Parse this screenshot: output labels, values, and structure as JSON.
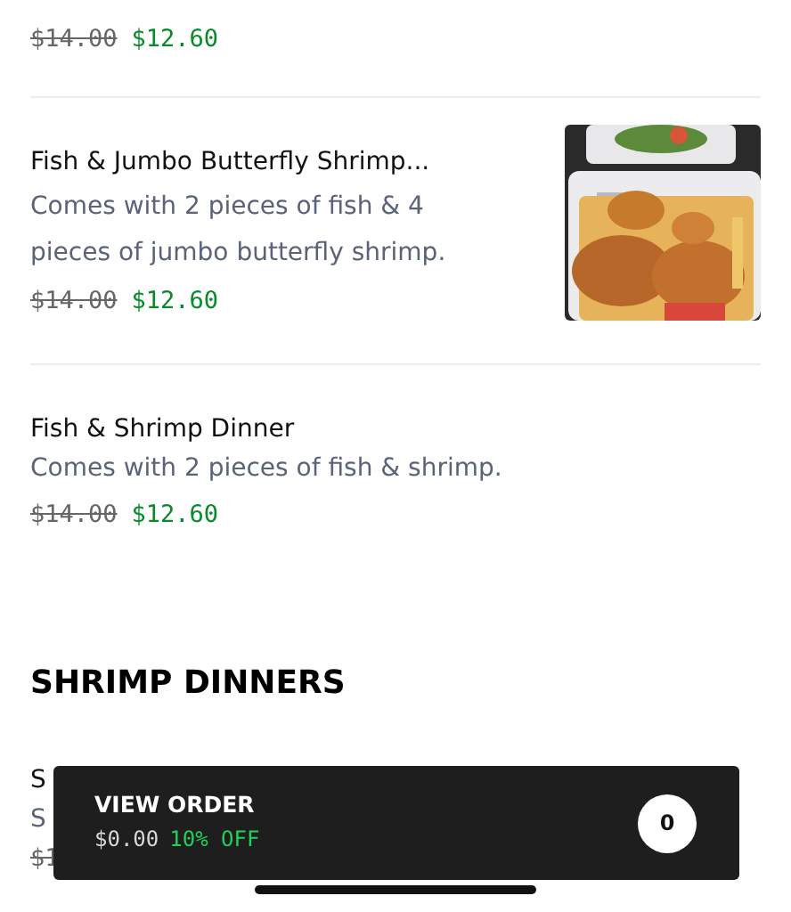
{
  "items": [
    {
      "kind": "plain",
      "old_price": "$14.00",
      "price": "$12.60"
    },
    {
      "kind": "with_picture",
      "name": "Fish & Jumbo Butterfly Shrimp...",
      "description": "Comes with 2 pieces of fish & 4 pieces of jumbo butterfly shrimp.",
      "old_price": "$14.00",
      "price": "$12.60"
    },
    {
      "kind": "plain",
      "name": "Fish & Shrimp Dinner",
      "description": "Comes with 2 pieces of fish & shrimp.",
      "old_price": "$14.00",
      "price": "$12.60"
    }
  ],
  "section_heading": "SHRIMP DINNERS",
  "partial_item": {
    "name": "S",
    "description": "S",
    "old_price": "$1"
  },
  "order_bar": {
    "title": "VIEW ORDER",
    "total": "$0.00",
    "discount": "10% OFF",
    "count": "0"
  }
}
